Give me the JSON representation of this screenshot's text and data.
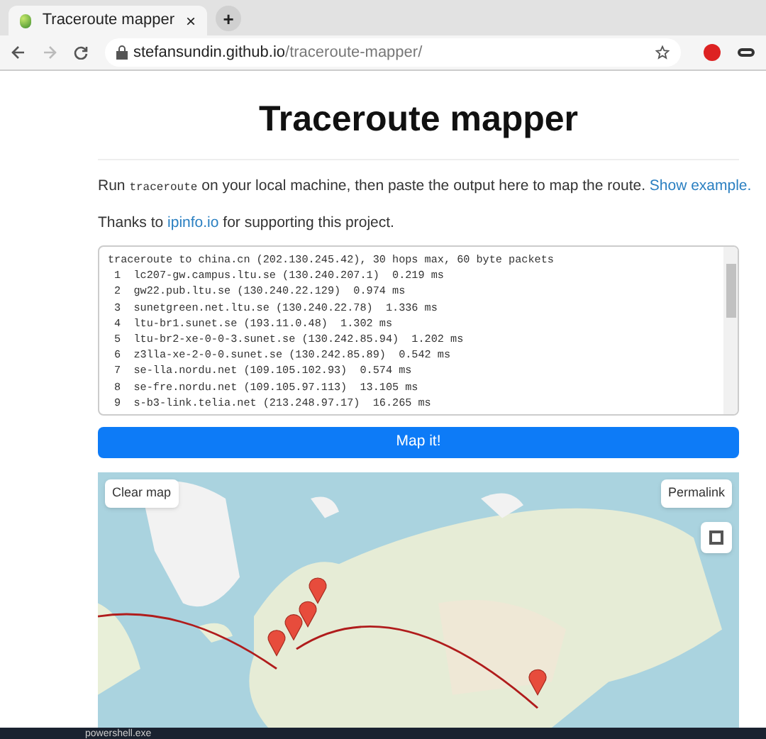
{
  "browser": {
    "tab": {
      "title": "Traceroute mapper",
      "close": "×"
    },
    "new_tab": "+",
    "url_host": "stefansundin.github.io",
    "url_path": "/traceroute-mapper/"
  },
  "page": {
    "title": "Traceroute mapper",
    "intro": {
      "before": "Run ",
      "code": "traceroute",
      "after": " on your local machine, then paste the output here to map the route. ",
      "link": "Show example."
    },
    "thanks": {
      "before": "Thanks to ",
      "link": "ipinfo.io",
      "after": " for supporting this project."
    },
    "output_lines": [
      "traceroute to china.cn (202.130.245.42), 30 hops max, 60 byte packets",
      " 1  lc207-gw.campus.ltu.se (130.240.207.1)  0.219 ms",
      " 2  gw22.pub.ltu.se (130.240.22.129)  0.974 ms",
      " 3  sunetgreen.net.ltu.se (130.240.22.78)  1.336 ms",
      " 4  ltu-br1.sunet.se (193.11.0.48)  1.302 ms",
      " 5  ltu-br2-xe-0-0-3.sunet.se (130.242.85.94)  1.202 ms",
      " 6  z3lla-xe-2-0-0.sunet.se (130.242.85.89)  0.542 ms",
      " 7  se-lla.nordu.net (109.105.102.93)  0.574 ms",
      " 8  se-fre.nordu.net (109.105.97.113)  13.105 ms",
      " 9  s-b3-link.telia.net (213.248.97.17)  16.265 ms"
    ],
    "map_button": "Map it!",
    "map": {
      "clear": "Clear map",
      "permalink": "Permalink"
    }
  },
  "taskbar": {
    "label": "powershell.exe"
  }
}
